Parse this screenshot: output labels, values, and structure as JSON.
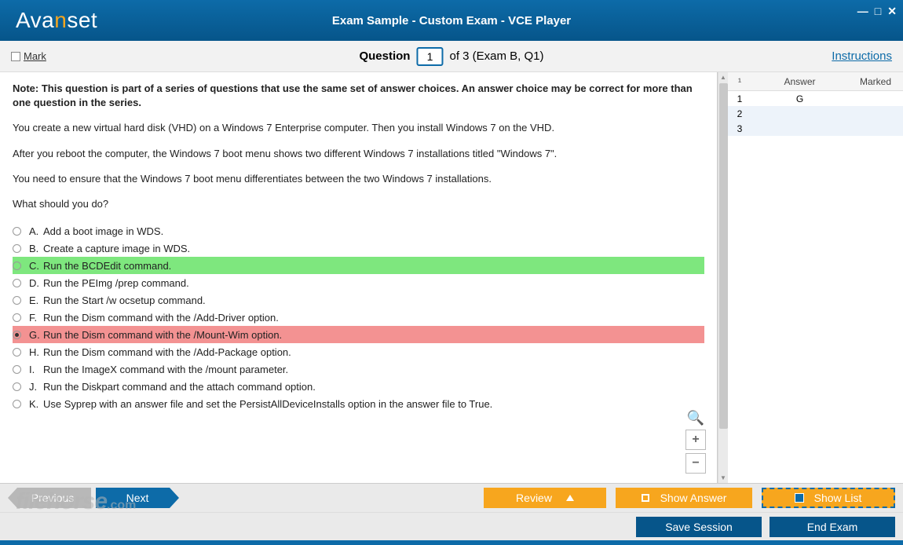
{
  "header": {
    "brand_left": "Ava",
    "brand_n": "n",
    "brand_right": "set",
    "title": "Exam Sample - Custom Exam - VCE Player"
  },
  "toolbar": {
    "mark_label": "Mark",
    "question_label": "Question",
    "question_number": "1",
    "total_text": "of 3 (Exam B, Q1)",
    "instructions_link": "Instructions"
  },
  "question": {
    "note": "Note: This question is part of a series of questions that use the same set of answer choices. An answer choice may be correct for more than one question in the series.",
    "para1": "You create a new virtual hard disk (VHD) on a Windows 7 Enterprise computer. Then you install Windows 7 on the VHD.",
    "para2": "After you reboot the computer, the Windows 7 boot menu shows two different Windows 7 installations titled \"Windows 7\".",
    "para3": "You need to ensure that the Windows 7 boot menu differentiates between the two Windows 7 installations.",
    "para4": "What should you do?",
    "choices": [
      {
        "letter": "A.",
        "text": "Add a boot image in WDS.",
        "state": ""
      },
      {
        "letter": "B.",
        "text": "Create a capture image in WDS.",
        "state": ""
      },
      {
        "letter": "C.",
        "text": "Run the BCDEdit command.",
        "state": "green"
      },
      {
        "letter": "D.",
        "text": "Run the PEImg /prep command.",
        "state": ""
      },
      {
        "letter": "E.",
        "text": "Run the Start /w ocsetup command.",
        "state": ""
      },
      {
        "letter": "F.",
        "text": "Run the Dism command with the /Add-Driver option.",
        "state": ""
      },
      {
        "letter": "G.",
        "text": "Run the Dism command with the /Mount-Wim option.",
        "state": "red"
      },
      {
        "letter": "H.",
        "text": "Run the Dism command with the /Add-Package option.",
        "state": ""
      },
      {
        "letter": "I.",
        "text": "Run the ImageX command with the /mount parameter.",
        "state": ""
      },
      {
        "letter": "J.",
        "text": "Run the Diskpart command and the attach command option.",
        "state": ""
      },
      {
        "letter": "K.",
        "text": "Use Syprep with an answer file and set the PersistAllDeviceInstalls option in the answer file to True.",
        "state": ""
      }
    ]
  },
  "sidepanel": {
    "col_num": "¹",
    "col_answer": "Answer",
    "col_marked": "Marked",
    "rows": [
      {
        "num": "1",
        "answer": "G",
        "marked": ""
      },
      {
        "num": "2",
        "answer": "",
        "marked": ""
      },
      {
        "num": "3",
        "answer": "",
        "marked": ""
      }
    ]
  },
  "navbar": {
    "previous": "Previous",
    "next": "Next",
    "review": "Review",
    "show_answer": "Show Answer",
    "show_list": "Show List"
  },
  "footer": {
    "save_session": "Save Session",
    "end_exam": "End Exam"
  },
  "watermark": {
    "text": "filehorse",
    "suffix": ".com"
  },
  "zoom": {
    "plus": "+",
    "minus": "−"
  }
}
